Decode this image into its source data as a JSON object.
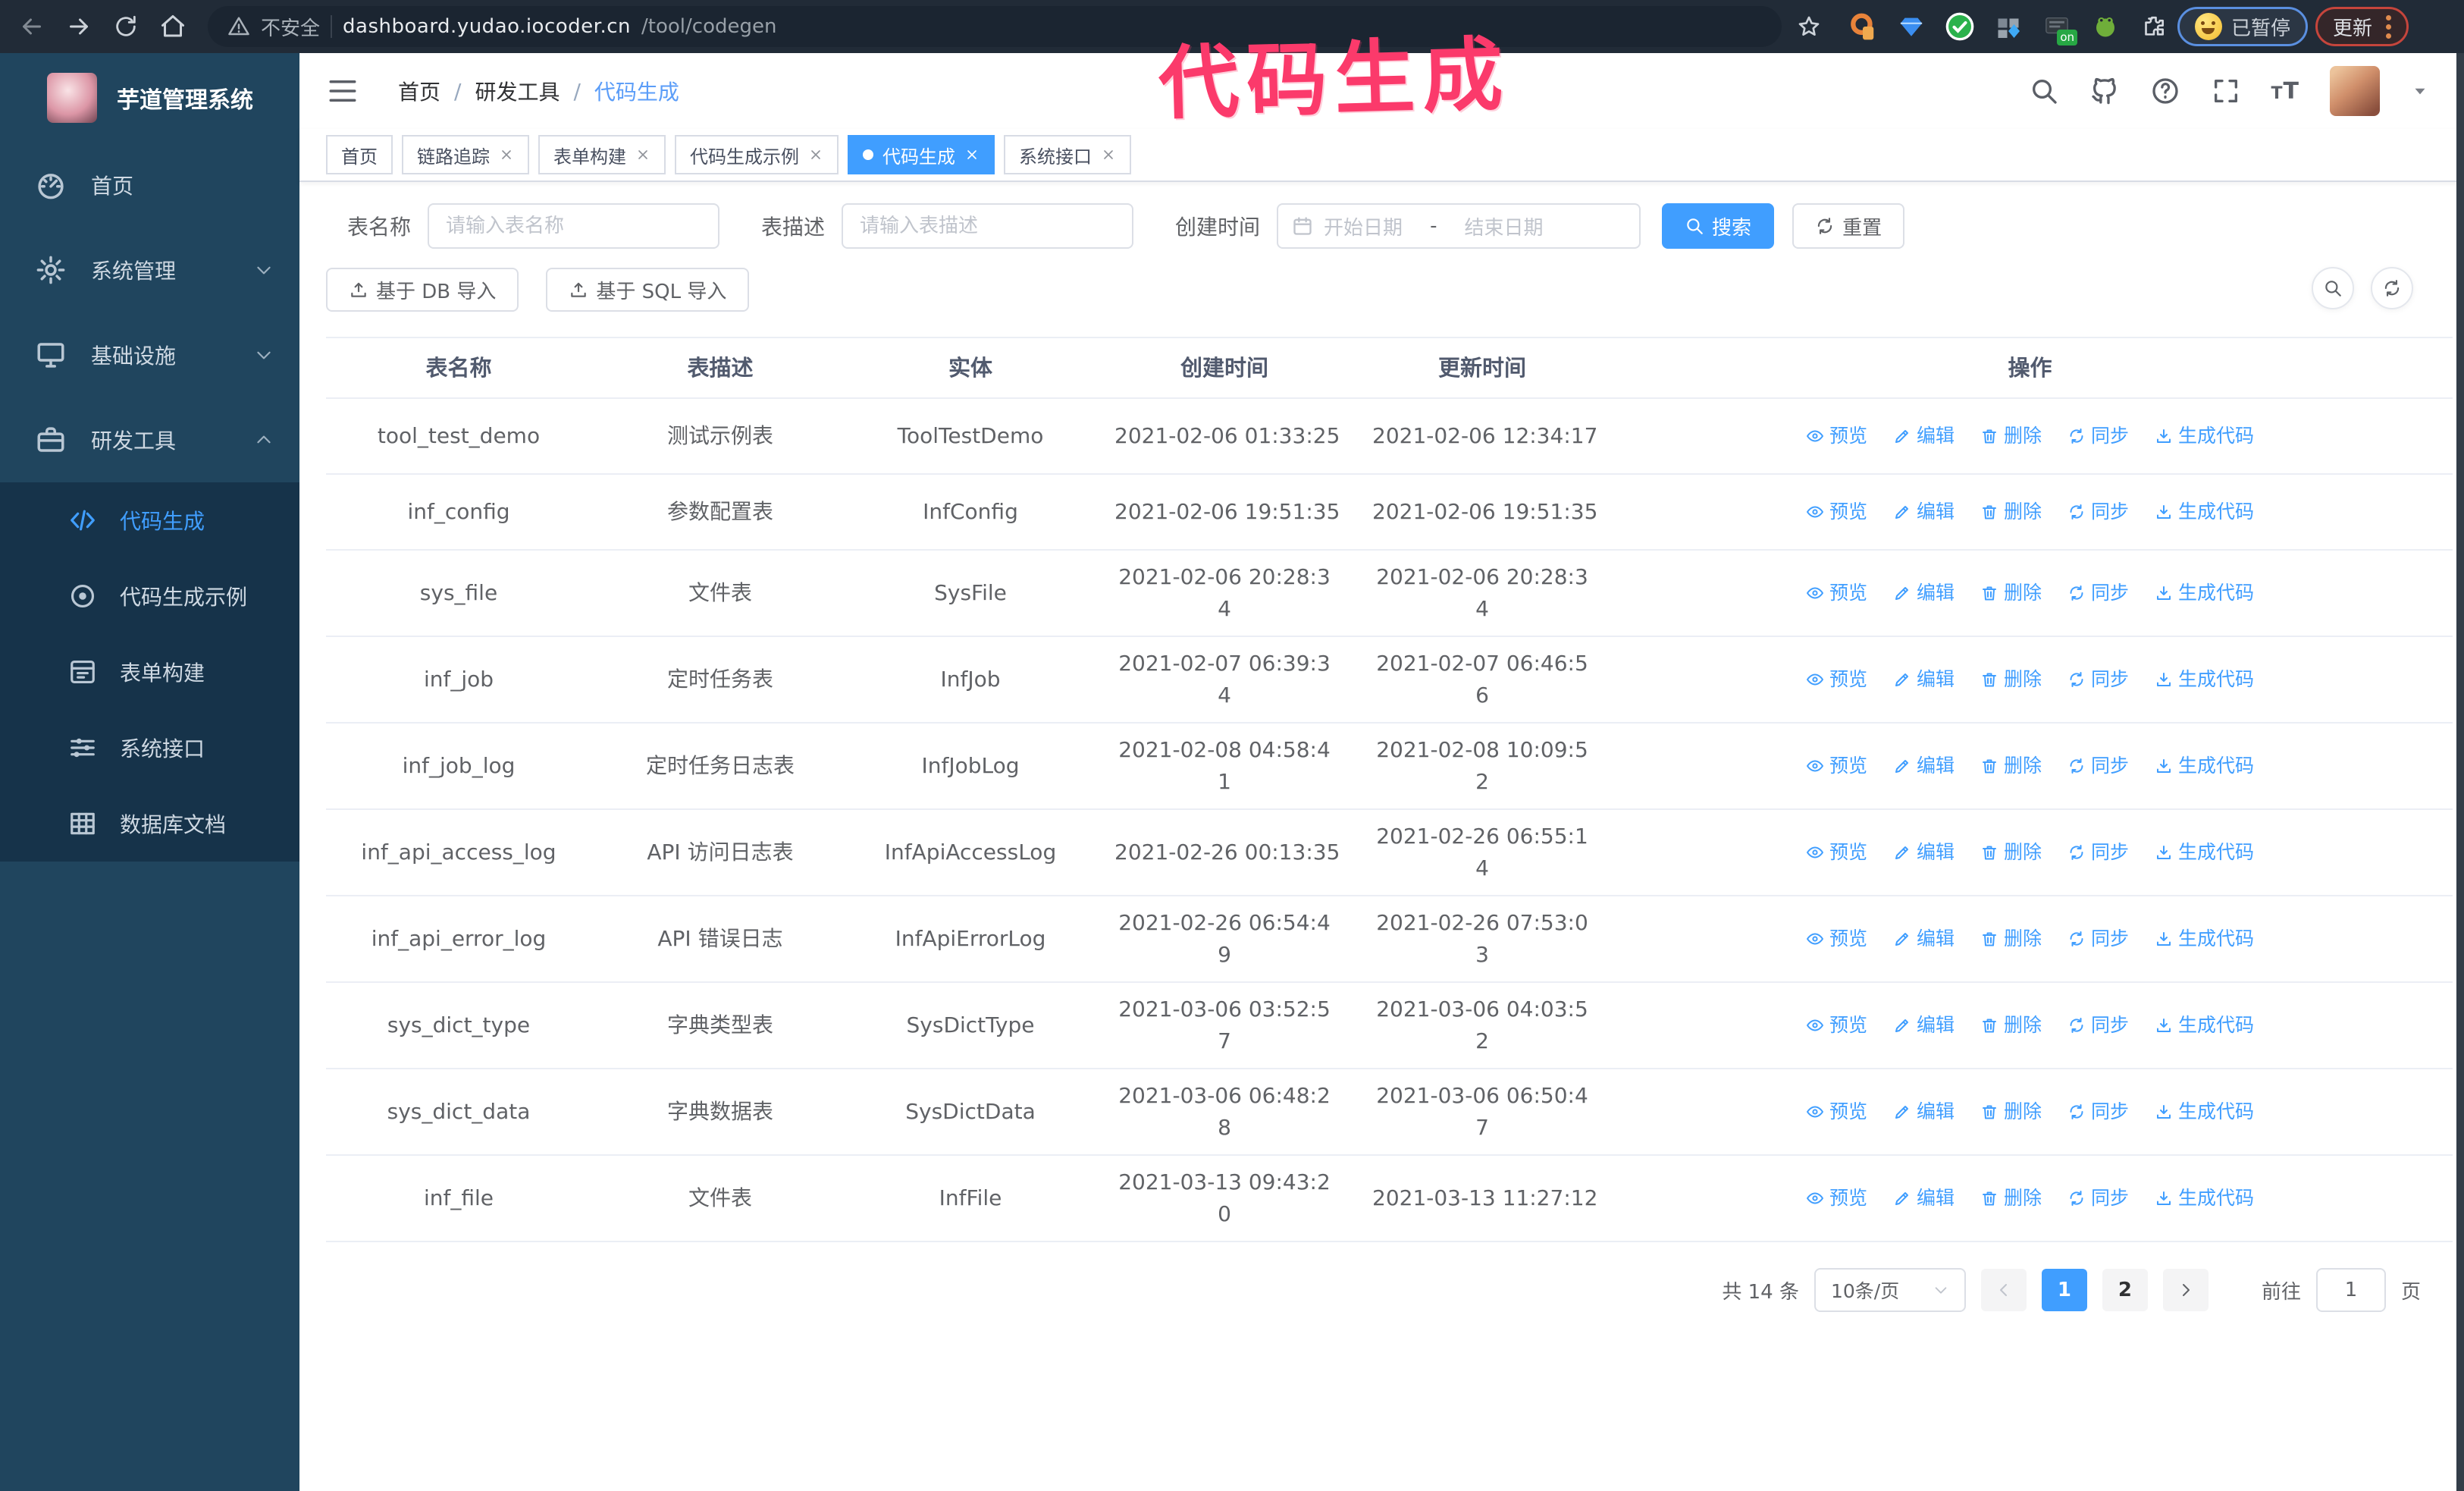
{
  "browser": {
    "security_label": "不安全",
    "url_host": "dashboard.yudao.iocoder.cn",
    "url_path": "/tool/codegen",
    "ext_on_badge": "on",
    "profile_chip": "已暂停",
    "update_button": "更新"
  },
  "watermark": "代码生成",
  "sidebar": {
    "logo_title": "芋道管理系统",
    "items": [
      {
        "label": "首页"
      },
      {
        "label": "系统管理"
      },
      {
        "label": "基础设施"
      },
      {
        "label": "研发工具"
      }
    ],
    "submenu": [
      {
        "label": "代码生成",
        "active": true
      },
      {
        "label": "代码生成示例"
      },
      {
        "label": "表单构建"
      },
      {
        "label": "系统接口"
      },
      {
        "label": "数据库文档"
      }
    ]
  },
  "header": {
    "breadcrumb": [
      "首页",
      "研发工具",
      "代码生成"
    ],
    "breadcrumb_separator": "/"
  },
  "tabs": [
    {
      "label": "首页"
    },
    {
      "label": "链路追踪"
    },
    {
      "label": "表单构建"
    },
    {
      "label": "代码生成示例"
    },
    {
      "label": "代码生成",
      "active": true
    },
    {
      "label": "系统接口"
    }
  ],
  "filters": {
    "table_name_label": "表名称",
    "table_name_value": "",
    "table_name_placeholder": "请输入表名称",
    "table_desc_label": "表描述",
    "table_desc_value": "",
    "table_desc_placeholder": "请输入表描述",
    "create_time_label": "创建时间",
    "date_start_placeholder": "开始日期",
    "date_separator": "-",
    "date_end_placeholder": "结束日期",
    "search_button": "搜索",
    "reset_button": "重置"
  },
  "toolbar": {
    "import_db_button": "基于 DB 导入",
    "import_sql_button": "基于 SQL 导入"
  },
  "table": {
    "columns": [
      "表名称",
      "表描述",
      "实体",
      "创建时间",
      "更新时间",
      "操作"
    ],
    "action_labels": [
      "预览",
      "编辑",
      "删除",
      "同步",
      "生成代码"
    ],
    "rows": [
      {
        "name": "tool_test_demo",
        "desc": "测试示例表",
        "entity": "ToolTestDemo",
        "created": "2021-02-06 01:33:25",
        "updated": "2021-02-06 12:34:17"
      },
      {
        "name": "inf_config",
        "desc": "参数配置表",
        "entity": "InfConfig",
        "created": "2021-02-06 19:51:35",
        "updated": "2021-02-06 19:51:35"
      },
      {
        "name": "sys_file",
        "desc": "文件表",
        "entity": "SysFile",
        "created": "2021-02-06 20:28:34",
        "updated": "2021-02-06 20:28:34"
      },
      {
        "name": "inf_job",
        "desc": "定时任务表",
        "entity": "InfJob",
        "created": "2021-02-07 06:39:34",
        "updated": "2021-02-07 06:46:56"
      },
      {
        "name": "inf_job_log",
        "desc": "定时任务日志表",
        "entity": "InfJobLog",
        "created": "2021-02-08 04:58:41",
        "updated": "2021-02-08 10:09:52"
      },
      {
        "name": "inf_api_access_log",
        "desc": "API 访问日志表",
        "entity": "InfApiAccessLog",
        "created": "2021-02-26 00:13:35",
        "updated": "2021-02-26 06:55:14"
      },
      {
        "name": "inf_api_error_log",
        "desc": "API 错误日志",
        "entity": "InfApiErrorLog",
        "created": "2021-02-26 06:54:49",
        "updated": "2021-02-26 07:53:03"
      },
      {
        "name": "sys_dict_type",
        "desc": "字典类型表",
        "entity": "SysDictType",
        "created": "2021-03-06 03:52:57",
        "updated": "2021-03-06 04:03:52"
      },
      {
        "name": "sys_dict_data",
        "desc": "字典数据表",
        "entity": "SysDictData",
        "created": "2021-03-06 06:48:28",
        "updated": "2021-03-06 06:50:47"
      },
      {
        "name": "inf_file",
        "desc": "文件表",
        "entity": "InfFile",
        "created": "2021-03-13 09:43:20",
        "updated": "2021-03-13 11:27:12"
      }
    ]
  },
  "pagination": {
    "total": "共 14 条",
    "page_size": "10条/页",
    "pages": [
      "1",
      "2"
    ],
    "active_page": "1",
    "goto_label": "前往",
    "goto_value": "1",
    "page_label": "页"
  },
  "icons": {
    "security-warning-icon": "⚠",
    "search-icon": "🔍",
    "calendar-icon": "📅",
    "refresh-icon": "⟳",
    "upload-icon": "⤒",
    "eye-icon": "👁",
    "edit-icon": "✎",
    "delete-icon": "🗑",
    "sync-icon": "⇆",
    "download-icon": "⤓",
    "code-icon": "</>",
    "gear-icon": "⚙",
    "home-icon": "⌂"
  },
  "colors": {
    "accent": "#409eff",
    "sidebar_bg": "#20455e",
    "submenu_bg": "#16334a",
    "browser_bar": "#212b37",
    "link": "#409eff",
    "watermark": "#fb3a6b",
    "border": "#dcdfe6",
    "row_border": "#ebeef5"
  }
}
